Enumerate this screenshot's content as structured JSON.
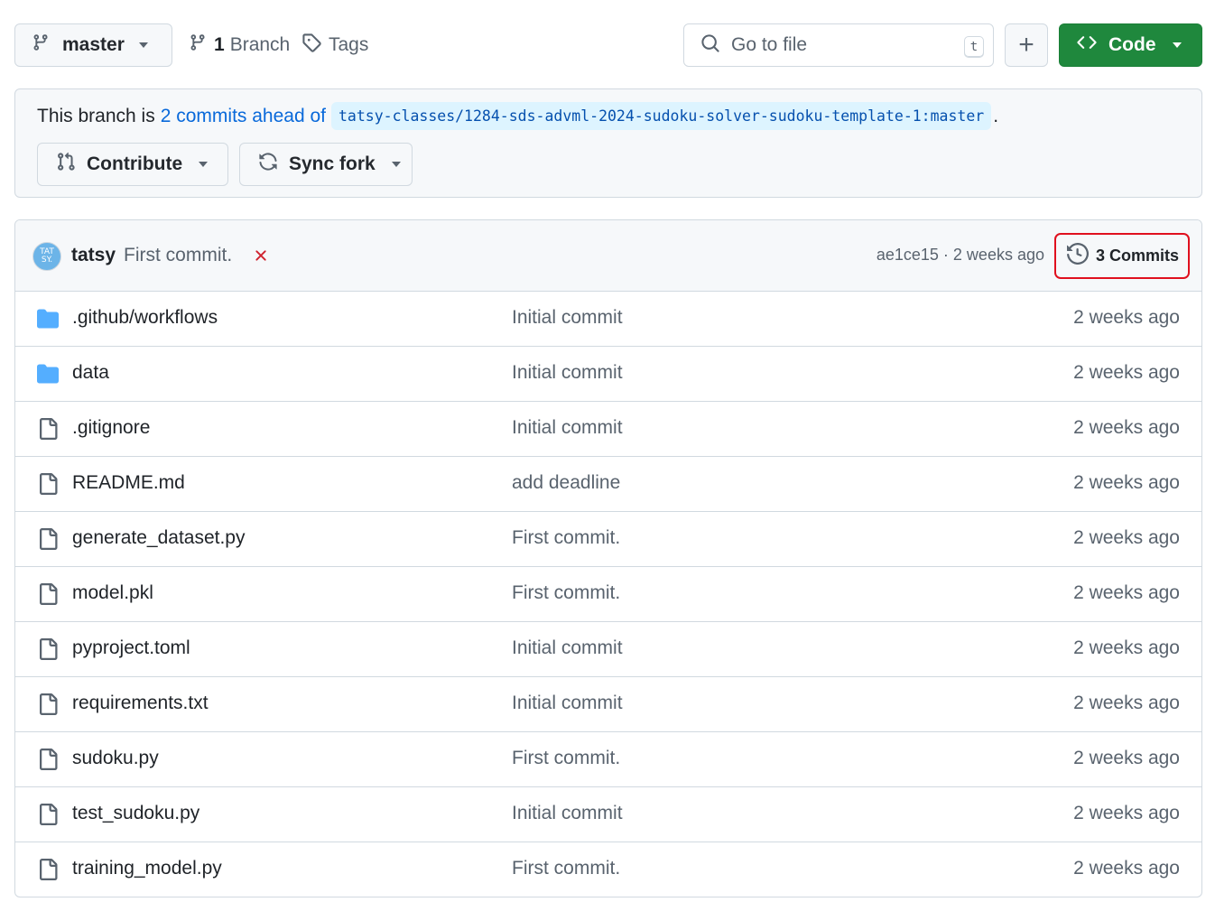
{
  "toolbar": {
    "branch_name": "master",
    "branches_count": "1",
    "branches_label": "Branch",
    "tags_label": "Tags",
    "search_placeholder": "Go to file",
    "search_shortcut": "t",
    "add_label": "+",
    "code_label": "Code"
  },
  "banner": {
    "text_prefix": "This branch is",
    "ahead_link": "2 commits ahead of",
    "upstream_ref": "tatsy-classes/1284-sds-advml-2024-sudoku-solver-sudoku-template-1:master",
    "text_suffix": ".",
    "contribute_label": "Contribute",
    "sync_label": "Sync fork"
  },
  "latest_commit": {
    "avatar_text_line1": "TAT",
    "avatar_text_line2": "SY.",
    "author": "tatsy",
    "message": "First commit.",
    "sha": "ae1ce15",
    "separator": "·",
    "time": "2 weeks ago",
    "commits_label": "3 Commits",
    "status_color": "#cf222e"
  },
  "files": [
    {
      "type": "dir",
      "name": ".github/workflows",
      "message": "Initial commit",
      "time": "2 weeks ago"
    },
    {
      "type": "dir",
      "name": "data",
      "message": "Initial commit",
      "time": "2 weeks ago"
    },
    {
      "type": "file",
      "name": ".gitignore",
      "message": "Initial commit",
      "time": "2 weeks ago"
    },
    {
      "type": "file",
      "name": "README.md",
      "message": "add deadline",
      "time": "2 weeks ago"
    },
    {
      "type": "file",
      "name": "generate_dataset.py",
      "message": "First commit.",
      "time": "2 weeks ago"
    },
    {
      "type": "file",
      "name": "model.pkl",
      "message": "First commit.",
      "time": "2 weeks ago"
    },
    {
      "type": "file",
      "name": "pyproject.toml",
      "message": "Initial commit",
      "time": "2 weeks ago"
    },
    {
      "type": "file",
      "name": "requirements.txt",
      "message": "Initial commit",
      "time": "2 weeks ago"
    },
    {
      "type": "file",
      "name": "sudoku.py",
      "message": "First commit.",
      "time": "2 weeks ago"
    },
    {
      "type": "file",
      "name": "test_sudoku.py",
      "message": "Initial commit",
      "time": "2 weeks ago"
    },
    {
      "type": "file",
      "name": "training_model.py",
      "message": "First commit.",
      "time": "2 weeks ago"
    }
  ],
  "colors": {
    "accent_blue": "#0969da",
    "folder_blue": "#54aeff",
    "code_green": "#1f883d",
    "highlight_red": "#e0101e"
  }
}
